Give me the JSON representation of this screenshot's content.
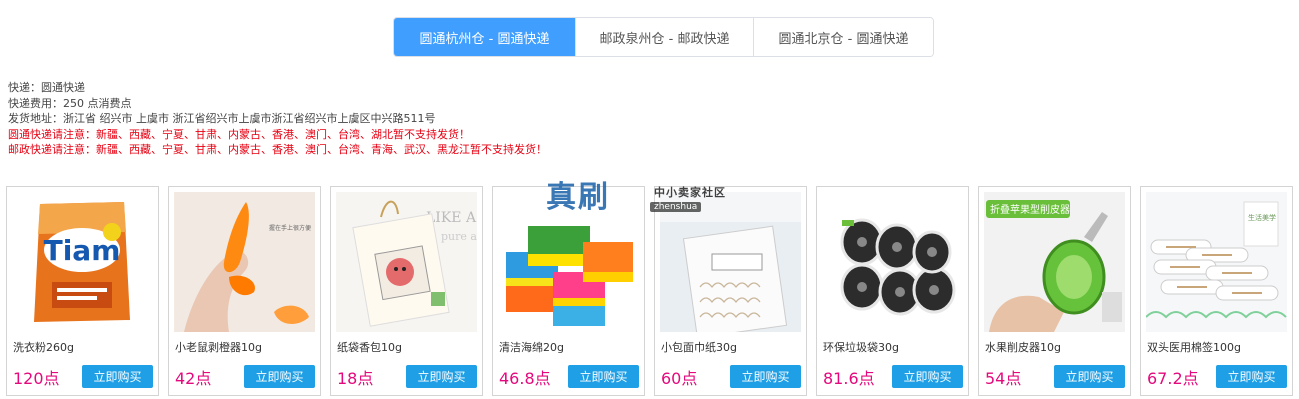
{
  "tabs": [
    {
      "label": "圆通杭州仓 - 圆通快递",
      "active": true
    },
    {
      "label": "邮政泉州仓 - 邮政快递",
      "active": false
    },
    {
      "label": "圆通北京仓 - 圆通快递",
      "active": false
    }
  ],
  "info": {
    "courier": "快递：圆通快递",
    "fee": "快递费用：250 点消费点",
    "address": "发货地址：浙江省 绍兴市 上虞市 浙江省绍兴市上虞市浙江省绍兴市上虞区中兴路511号",
    "yto_notice": "圆通快递请注意：新疆、西藏、宁夏、甘肃、内蒙古、香港、澳门、台湾、湖北暂不支持发货！",
    "ems_notice": "邮政快递请注意：新疆、西藏、宁夏、甘肃、内蒙古、香港、澳门、台湾、青海、武汉、黑龙江暂不支持发货！"
  },
  "colors": {
    "active_tab": "#409eff",
    "price": "#e4097c",
    "buy_button": "#1e9fe6",
    "warning": "#e60012"
  },
  "watermark": {
    "big": "真刷",
    "small": "中小卖家社区",
    "latin": "zhenshua"
  },
  "products": [
    {
      "name": "洗衣粉260g",
      "price": "120点",
      "buy": "立即购买",
      "image": "detergent-pack"
    },
    {
      "name": "小老鼠剥橙器10g",
      "price": "42点",
      "buy": "立即购买",
      "image": "orange-peeler"
    },
    {
      "name": "纸袋香包10g",
      "price": "18点",
      "buy": "立即购买",
      "image": "sachet"
    },
    {
      "name": "清洁海绵20g",
      "price": "46.8点",
      "buy": "立即购买",
      "image": "sponges"
    },
    {
      "name": "小包面巾纸30g",
      "price": "60点",
      "buy": "立即购买",
      "image": "tissue-pack"
    },
    {
      "name": "环保垃圾袋30g",
      "price": "81.6点",
      "buy": "立即购买",
      "image": "garbage-bags"
    },
    {
      "name": "水果削皮器10g",
      "price": "54点",
      "buy": "立即购买",
      "image": "fruit-peeler"
    },
    {
      "name": "双头医用棉签100g",
      "price": "67.2点",
      "buy": "立即购买",
      "image": "cotton-swabs"
    }
  ]
}
